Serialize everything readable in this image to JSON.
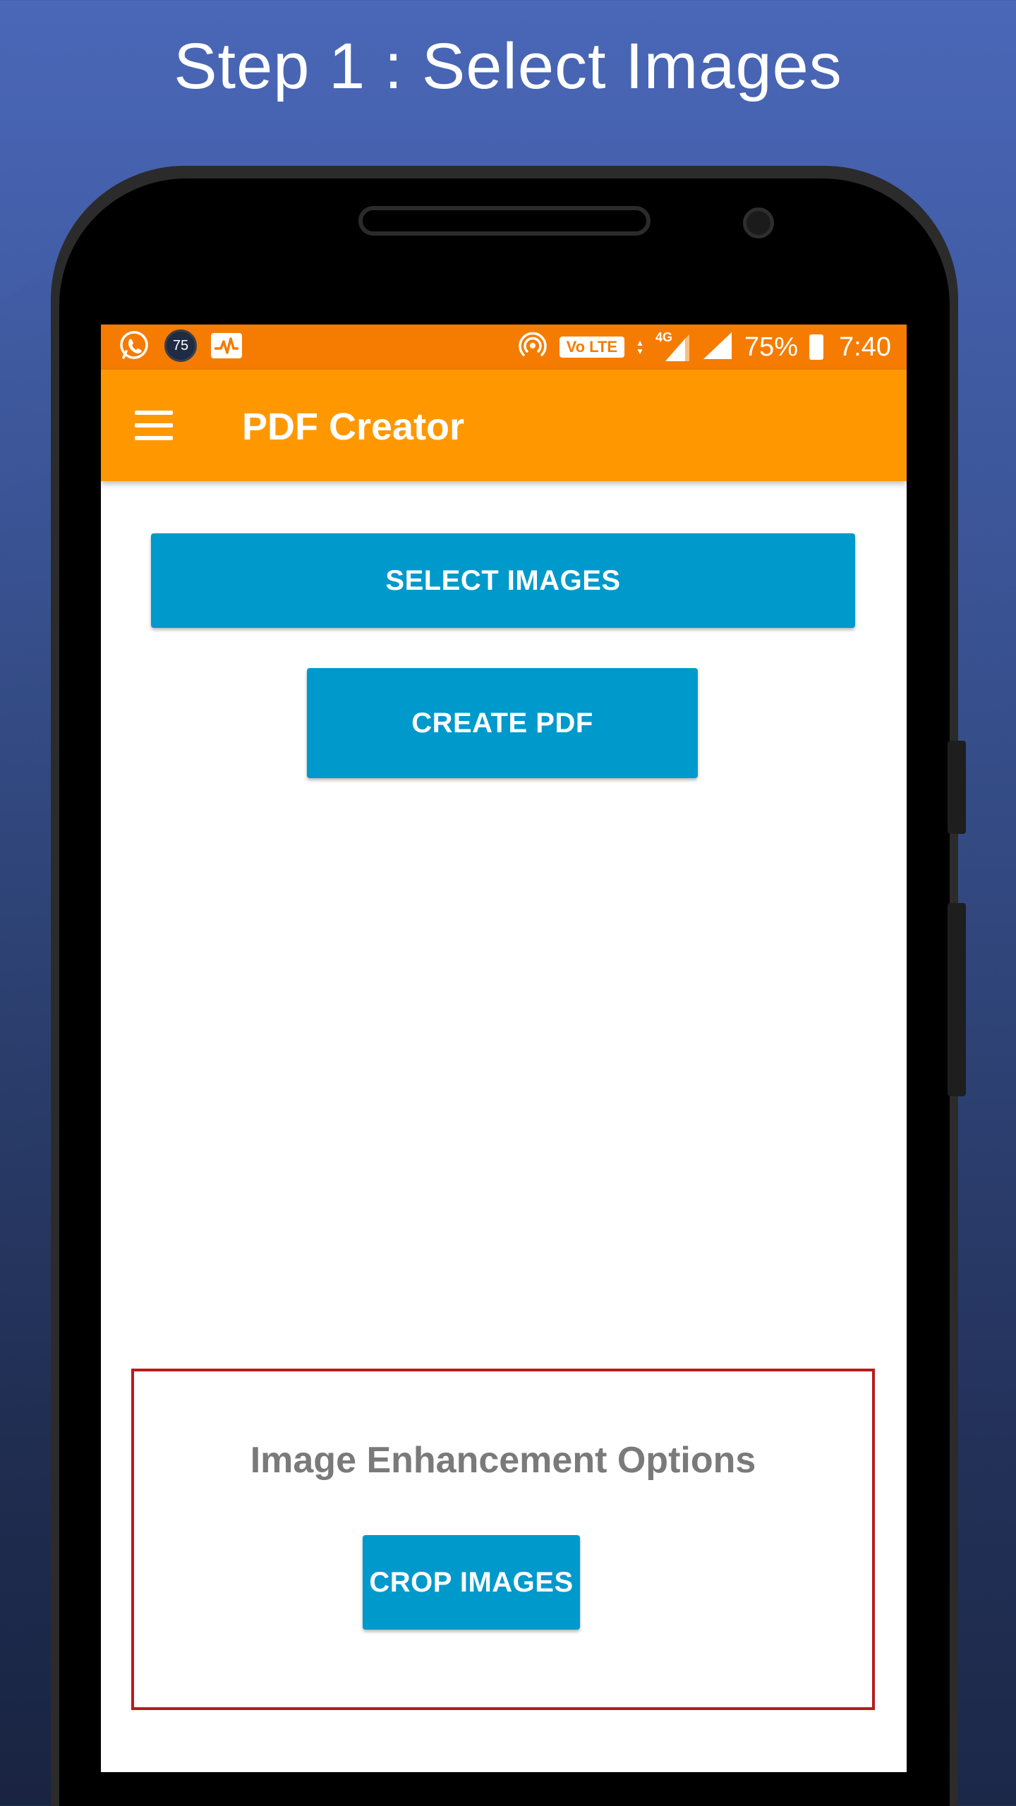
{
  "promo": {
    "title": "Step 1 : Select Images"
  },
  "status_bar": {
    "left_icons": [
      "whatsapp-icon",
      "notification-badge",
      "activity-monitor-icon"
    ],
    "badge_text": "75",
    "volte_label": "Vo LTE",
    "network_label": "4G",
    "battery_percent": "75%",
    "time": "7:40",
    "color": "#f57c00"
  },
  "app_bar": {
    "title": "PDF Creator",
    "color": "#ff9800"
  },
  "buttons": {
    "select_images": "SELECT IMAGES",
    "create_pdf": "CREATE PDF",
    "crop_images": "CROP IMAGES",
    "color": "#0099cc"
  },
  "enhancement": {
    "title": "Image Enhancement Options",
    "border_color": "#b71c1c"
  }
}
